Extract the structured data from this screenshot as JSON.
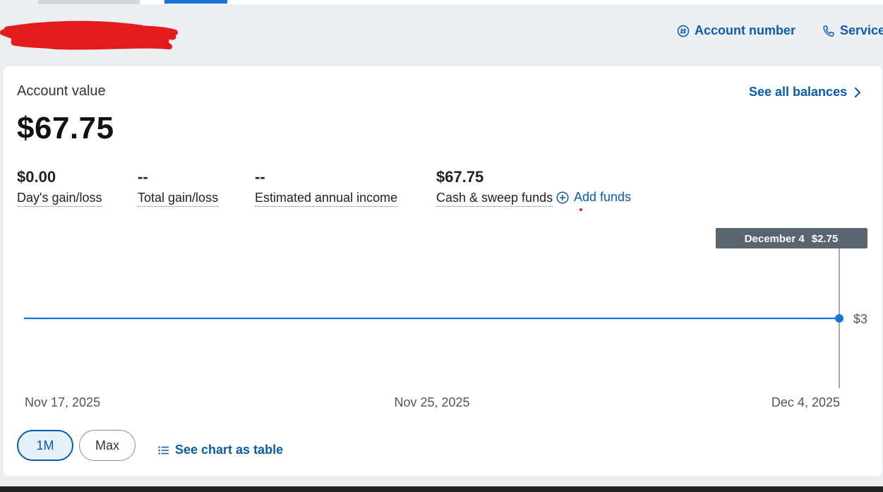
{
  "header": {
    "account_number_label": "Account number",
    "service_label": "Service"
  },
  "summary": {
    "title": "Account value",
    "value": "$67.75",
    "see_all_label": "See all balances"
  },
  "stats": [
    {
      "value": "$0.00",
      "label": "Day's gain/loss"
    },
    {
      "value": "--",
      "label": "Total gain/loss"
    },
    {
      "value": "--",
      "label": "Estimated annual income"
    },
    {
      "value": "$67.75",
      "label": "Cash & sweep funds"
    }
  ],
  "add_funds_label": "Add funds",
  "chart_data": {
    "type": "line",
    "x": [
      "Nov 17, 2025",
      "Dec 4, 2025"
    ],
    "series": [
      {
        "values": [
          3,
          3
        ]
      }
    ],
    "x_tick_labels": [
      "Nov 17, 2025",
      "Nov 25, 2025",
      "Dec 4, 2025"
    ],
    "y_tick_labels": [
      "$3"
    ],
    "tooltip": {
      "date": "December 4",
      "value": "$2.75"
    },
    "line_color": "#1a73d9"
  },
  "range_buttons": {
    "one_month": "1M",
    "max": "Max",
    "selected": "1M"
  },
  "see_chart_table_label": "See chart as table",
  "colors": {
    "link": "#0a5bab",
    "accent": "#1a73d9",
    "tooltip_bg": "#5a6470"
  }
}
